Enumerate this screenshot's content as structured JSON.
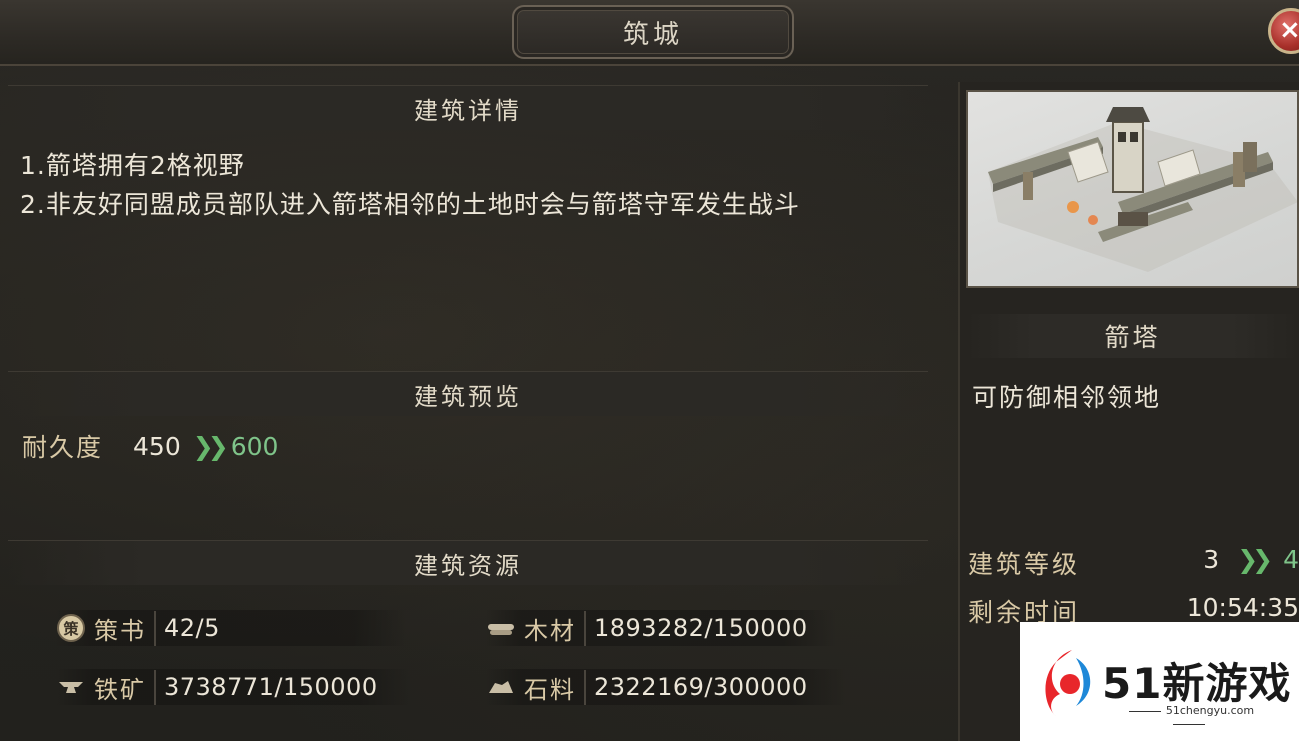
{
  "window": {
    "title": "筑城",
    "close_icon": "×"
  },
  "details": {
    "header": "建筑详情",
    "lines": [
      "1.箭塔拥有2格视野",
      "2.非友好同盟成员部队进入箭塔相邻的土地时会与箭塔守军发生战斗"
    ]
  },
  "preview_section": {
    "header": "建筑预览",
    "stat": {
      "label": "耐久度",
      "from": "450",
      "to": "600"
    }
  },
  "resources_section": {
    "header": "建筑资源",
    "items": [
      {
        "icon": "bamboo-scroll-icon",
        "icon_text": "策",
        "label": "策书",
        "value": "42/5"
      },
      {
        "icon": "wood-log-icon",
        "label": "木材",
        "value": "1893282/150000"
      },
      {
        "icon": "iron-anvil-icon",
        "label": "铁矿",
        "value": "3738771/150000"
      },
      {
        "icon": "stone-icon",
        "label": "石料",
        "value": "2322169/300000"
      }
    ]
  },
  "building": {
    "name": "箭塔",
    "description": "可防御相邻领地",
    "level": {
      "label": "建筑等级",
      "from": "3",
      "to": "4"
    },
    "time": {
      "label": "剩余时间",
      "value": "10:54:35"
    }
  },
  "watermark": {
    "brand": "51新游戏",
    "url": "51chengyu.com"
  },
  "colors": {
    "accent_green": "#67b86c",
    "label_gold": "#d9c9a6",
    "close_red": "#a8302a"
  }
}
